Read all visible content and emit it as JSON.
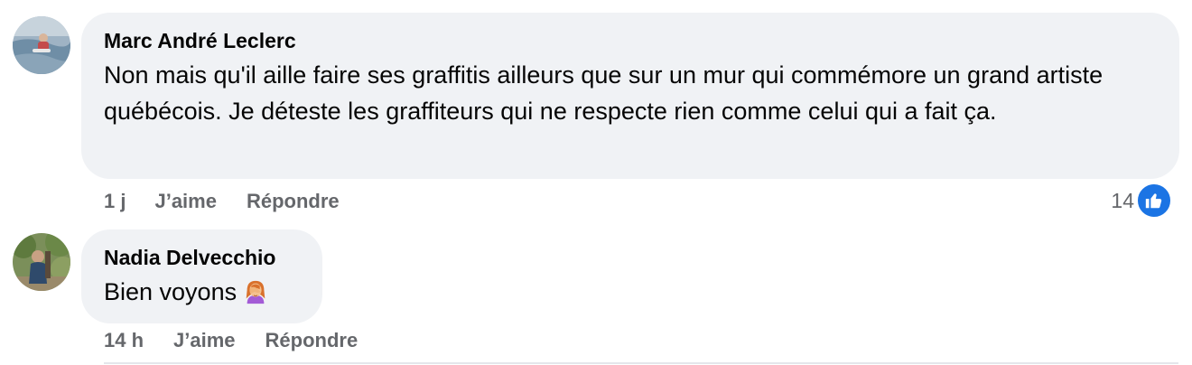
{
  "comments": [
    {
      "author": "Marc André Leclerc",
      "text": "Non mais qu'il aille faire ses graffitis ailleurs que sur un mur qui commémore un grand artiste québécois. Je déteste les graffiteurs qui ne respecte rien comme celui qui a fait ça.",
      "time": "1 j",
      "like_label": "J’aime",
      "reply_label": "Répondre",
      "reaction_count": "14",
      "reaction_icon": "like-icon",
      "avatar_icon": "avatar-beach-icon"
    },
    {
      "author": "Nadia Delvecchio",
      "text": "Bien voyons",
      "emoji_icon": "woman-facepalming-icon",
      "time": "14 h",
      "like_label": "J’aime",
      "reply_label": "Répondre",
      "avatar_icon": "avatar-outdoor-icon"
    }
  ],
  "colors": {
    "bubble": "#f0f2f5",
    "meta_text": "#65676b",
    "like_blue": "#1b74e4",
    "divider": "#e4e6eb"
  }
}
